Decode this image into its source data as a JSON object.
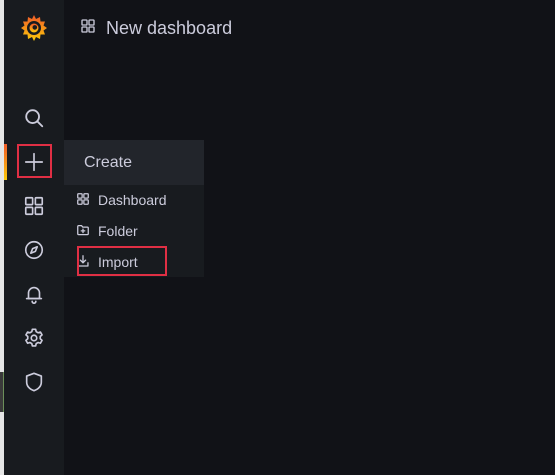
{
  "header": {
    "title": "New dashboard",
    "icon": "apps-grid-icon"
  },
  "sidebar": {
    "logo": "grafana-logo",
    "items": [
      {
        "name": "search",
        "icon": "search-icon"
      },
      {
        "name": "create",
        "icon": "plus-icon",
        "active": true,
        "highlighted": true
      },
      {
        "name": "dashboards",
        "icon": "apps-grid-icon"
      },
      {
        "name": "explore",
        "icon": "compass-icon"
      },
      {
        "name": "alerting",
        "icon": "bell-icon"
      },
      {
        "name": "configuration",
        "icon": "gear-icon"
      },
      {
        "name": "server-admin",
        "icon": "shield-icon"
      }
    ]
  },
  "create_menu": {
    "title": "Create",
    "items": [
      {
        "label": "Dashboard",
        "icon": "apps-grid-icon"
      },
      {
        "label": "Folder",
        "icon": "folder-plus-icon"
      },
      {
        "label": "Import",
        "icon": "import-icon",
        "highlighted": true
      }
    ]
  },
  "colors": {
    "background": "#111217",
    "sidebar": "#181b1f",
    "menu_header": "#22252b",
    "text": "#ccccdc",
    "highlight": "#e02f44",
    "accent_start": "#f05a28",
    "accent_end": "#fbca0a"
  }
}
